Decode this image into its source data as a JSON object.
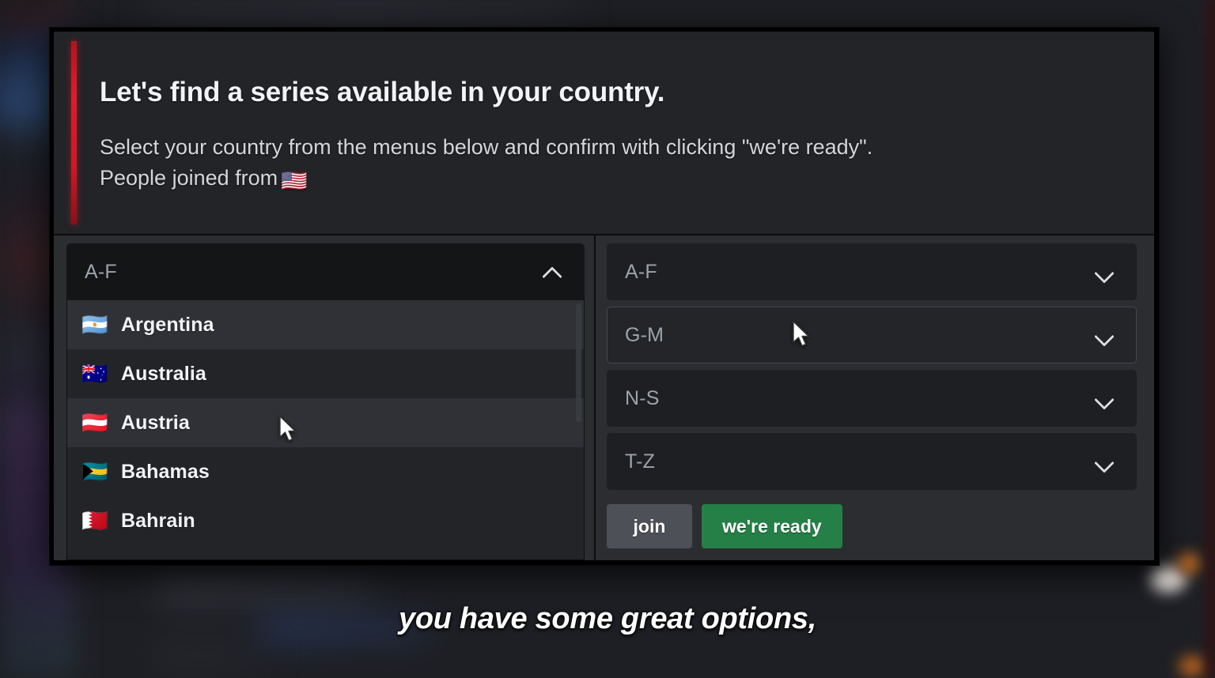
{
  "background": {
    "app_hint": "blurred-chat-application"
  },
  "dialog": {
    "title": "Let's find a series available in your country.",
    "description_line1": "Select your country from the menus below and confirm with clicking \"we're ready\".",
    "description_line2": "People joined from",
    "description_flag": "🇺🇸",
    "accent_color": "#d01825"
  },
  "left_panel": {
    "select": {
      "label": "A-F",
      "state": "open",
      "chevron": "chevron-up-icon"
    },
    "options": [
      {
        "flag": "🇦🇷",
        "label": "Argentina",
        "highlighted": true
      },
      {
        "flag": "🇦🇺",
        "label": "Australia",
        "highlighted": false
      },
      {
        "flag": "🇦🇹",
        "label": "Austria",
        "highlighted": true
      },
      {
        "flag": "🇧🇸",
        "label": "Bahamas",
        "highlighted": false
      },
      {
        "flag": "🇧🇭",
        "label": "Bahrain",
        "highlighted": false
      }
    ]
  },
  "right_panel": {
    "selects": [
      {
        "label": "A-F",
        "chevron": "chevron-down-icon",
        "hover": false
      },
      {
        "label": "G-M",
        "chevron": "chevron-down-icon",
        "hover": true
      },
      {
        "label": "N-S",
        "chevron": "chevron-down-icon",
        "hover": false
      },
      {
        "label": "T-Z",
        "chevron": "chevron-down-icon",
        "hover": false
      }
    ],
    "buttons": {
      "join_label": "join",
      "ready_label": "we're ready",
      "join_color": "#4e5058",
      "ready_color": "#248046"
    }
  },
  "caption": {
    "text": "you have some great options,"
  }
}
